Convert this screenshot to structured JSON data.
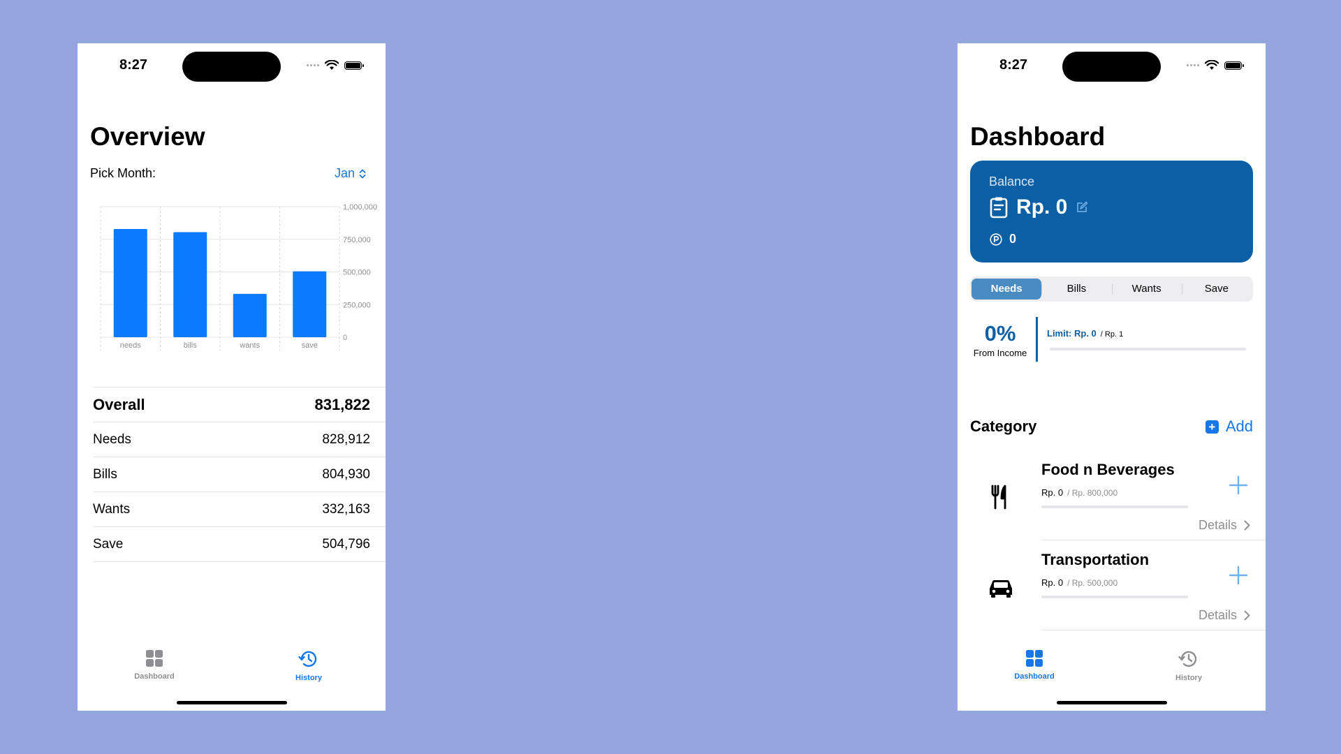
{
  "overview_screen": {
    "status_time": "8:27",
    "title": "Overview",
    "pick_month_label": "Pick Month:",
    "pick_month_value": "Jan",
    "chart_data": {
      "type": "bar",
      "categories": [
        "needs",
        "bills",
        "wants",
        "save"
      ],
      "values": [
        828912,
        804930,
        332163,
        504796
      ],
      "ylim": [
        0,
        1000000
      ],
      "yticks": [
        0,
        250000,
        500000,
        750000,
        1000000
      ],
      "ytick_labels": [
        "0",
        "250,000",
        "500,000",
        "750,000",
        "1,000,000"
      ],
      "bar_color": "#0A7AFF",
      "grid": true
    },
    "summary": {
      "overall_label": "Overall",
      "overall_value": "831,822",
      "rows": [
        {
          "label": "Needs",
          "value": "828,912"
        },
        {
          "label": "Bills",
          "value": "804,930"
        },
        {
          "label": "Wants",
          "value": "332,163"
        },
        {
          "label": "Save",
          "value": "504,796"
        }
      ]
    },
    "tabs": [
      {
        "label": "Dashboard",
        "icon": "dashboard-grid-icon",
        "active": false
      },
      {
        "label": "History",
        "icon": "history-clock-icon",
        "active": true
      }
    ]
  },
  "dashboard_screen": {
    "status_time": "8:27",
    "title": "Dashboard",
    "balance": {
      "label": "Balance",
      "amount": "Rp. 0",
      "points": "0",
      "card_color": "#0B5FA5"
    },
    "segments": [
      "Needs",
      "Bills",
      "Wants",
      "Save"
    ],
    "active_segment": "Needs",
    "percent": "0%",
    "percent_caption": "From Income",
    "limit_label": "Limit: Rp. 0",
    "limit_of": "/ Rp. 1",
    "category_title": "Category",
    "add_label": "Add",
    "categories": [
      {
        "name": "Food n Beverages",
        "amount": "Rp. 0",
        "limit": "/ Rp. 800,000",
        "details": "Details",
        "icon": "fork-knife-icon"
      },
      {
        "name": "Transportation",
        "amount": "Rp. 0",
        "limit": "/ Rp. 500,000",
        "details": "Details",
        "icon": "car-icon"
      }
    ],
    "tabs": [
      {
        "label": "Dashboard",
        "icon": "dashboard-grid-icon",
        "active": true
      },
      {
        "label": "History",
        "icon": "history-clock-icon",
        "active": false
      }
    ],
    "accent_color": "#1877E6"
  }
}
